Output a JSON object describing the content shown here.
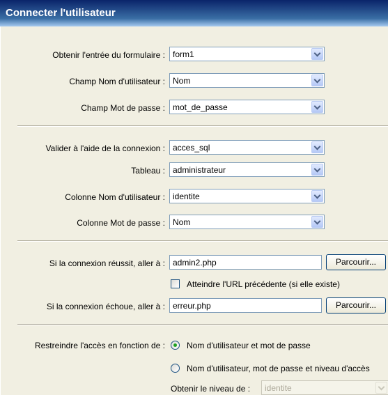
{
  "title": "Connecter l'utilisateur",
  "form_section": {
    "form_label": "Obtenir l'entrée du formulaire :",
    "form_value": "form1",
    "username_field_label": "Champ Nom d'utilisateur :",
    "username_field_value": "Nom",
    "password_field_label": "Champ Mot de passe :",
    "password_field_value": "mot_de_passe"
  },
  "db_section": {
    "connection_label": "Valider à l'aide de la connexion :",
    "connection_value": "acces_sql",
    "table_label": "Tableau :",
    "table_value": "administrateur",
    "username_col_label": "Colonne Nom d'utilisateur :",
    "username_col_value": "identite",
    "password_col_label": "Colonne Mot de passe :",
    "password_col_value": "Nom"
  },
  "redirect_section": {
    "success_label": "Si la connexion réussit, aller à :",
    "success_value": "admin2.php",
    "browse_label": "Parcourir...",
    "previous_url_label": "Atteindre l'URL précédente (si elle existe)",
    "failure_label": "Si la connexion échoue, aller à :",
    "failure_value": "erreur.php"
  },
  "access_section": {
    "restrict_label": "Restreindre l'accès en fonction de :",
    "option_user_pass": "Nom d'utilisateur et mot de passe",
    "option_user_pass_level": "Nom d'utilisateur, mot de passe et niveau d'accès",
    "level_label": "Obtenir le niveau de :",
    "level_value": "identite",
    "selected_option": "user_pass"
  },
  "icons": {
    "dropdown": "chevron-down-icon"
  }
}
